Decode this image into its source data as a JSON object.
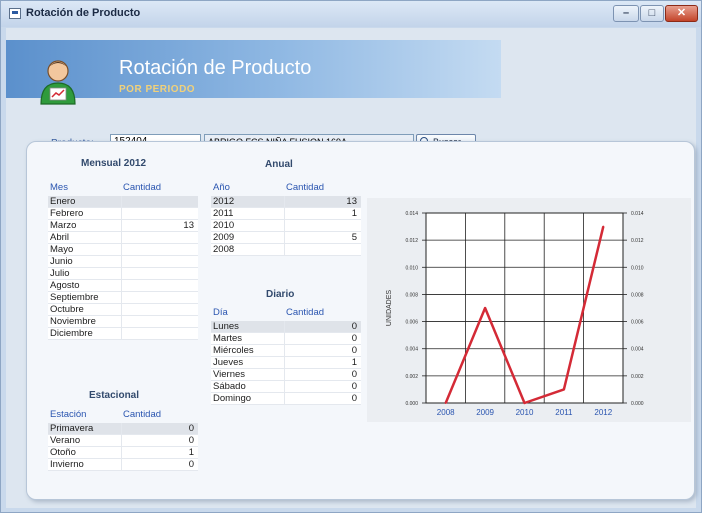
{
  "window": {
    "title": "Rotación de Producto",
    "min": "–",
    "max": "□",
    "close": "✕"
  },
  "banner": {
    "title": "Rotación de Producto",
    "subtitle": "POR PERIODO"
  },
  "product": {
    "label": "Producto:",
    "code": "152404",
    "description": "ABRIGO FCS NIÑA FUSION 169A",
    "search_label": "Buscar"
  },
  "mensual": {
    "title": "Mensual 2012",
    "col1": "Mes",
    "col2": "Cantidad",
    "rows": [
      {
        "name": "Enero",
        "qty": ""
      },
      {
        "name": "Febrero",
        "qty": ""
      },
      {
        "name": "Marzo",
        "qty": "13"
      },
      {
        "name": "Abril",
        "qty": ""
      },
      {
        "name": "Mayo",
        "qty": ""
      },
      {
        "name": "Junio",
        "qty": ""
      },
      {
        "name": "Julio",
        "qty": ""
      },
      {
        "name": "Agosto",
        "qty": ""
      },
      {
        "name": "Septiembre",
        "qty": ""
      },
      {
        "name": "Octubre",
        "qty": ""
      },
      {
        "name": "Noviembre",
        "qty": ""
      },
      {
        "name": "Diciembre",
        "qty": ""
      }
    ]
  },
  "estacional": {
    "title": "Estacional",
    "col1": "Estación",
    "col2": "Cantidad",
    "rows": [
      {
        "name": "Primavera",
        "qty": "0"
      },
      {
        "name": "Verano",
        "qty": "0"
      },
      {
        "name": "Otoño",
        "qty": "1"
      },
      {
        "name": "Invierno",
        "qty": "0"
      }
    ]
  },
  "anual": {
    "title": "Anual",
    "col1": "Año",
    "col2": "Cantidad",
    "rows": [
      {
        "name": "2012",
        "qty": "13"
      },
      {
        "name": "2011",
        "qty": "1"
      },
      {
        "name": "2010",
        "qty": ""
      },
      {
        "name": "2009",
        "qty": "5"
      },
      {
        "name": "2008",
        "qty": ""
      }
    ]
  },
  "diario": {
    "title": "Diario",
    "col1": "Día",
    "col2": "Cantidad",
    "rows": [
      {
        "name": "Lunes",
        "qty": "0"
      },
      {
        "name": "Martes",
        "qty": "0"
      },
      {
        "name": "Miércoles",
        "qty": "0"
      },
      {
        "name": "Jueves",
        "qty": "1"
      },
      {
        "name": "Viernes",
        "qty": "0"
      },
      {
        "name": "Sábado",
        "qty": "0"
      },
      {
        "name": "Domingo",
        "qty": "0"
      }
    ]
  },
  "chart_data": {
    "type": "line",
    "title": "",
    "xlabel": "",
    "ylabel": "UNIDADES",
    "categories": [
      "2008",
      "2009",
      "2010",
      "2011",
      "2012"
    ],
    "series": [
      {
        "values": [
          0.0,
          0.007,
          0.0,
          0.001,
          0.013
        ]
      }
    ],
    "yticks": [
      "0.000",
      "0.002",
      "0.004",
      "0.006",
      "0.008",
      "0.010",
      "0.012",
      "0.014"
    ],
    "ylim": [
      0,
      0.014
    ],
    "grid": true,
    "line_color": "#d42a36"
  }
}
